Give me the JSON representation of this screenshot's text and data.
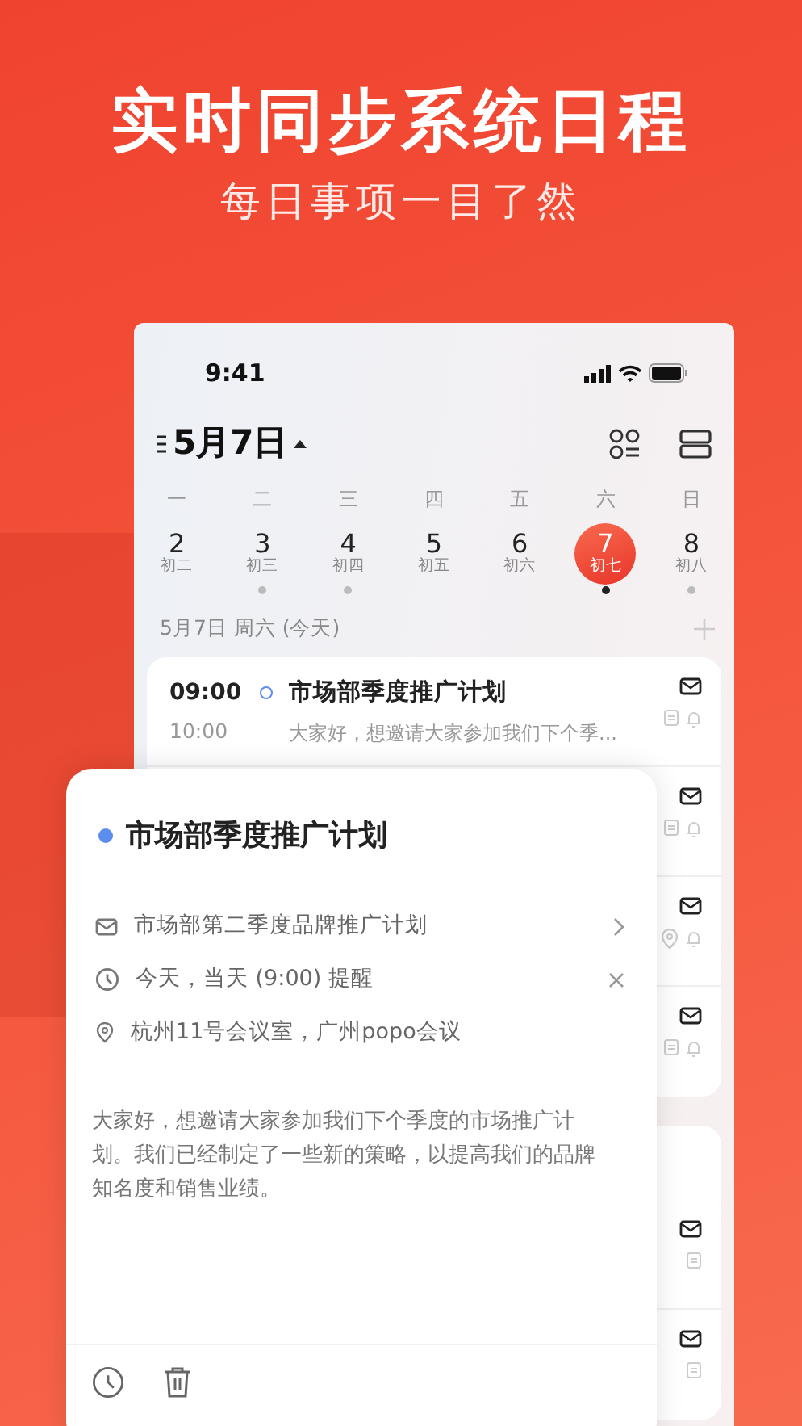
{
  "promo": {
    "title": "实时同步系统日程",
    "subtitle": "每日事项一目了然"
  },
  "status_bar": {
    "time": "9:41"
  },
  "header": {
    "date": "5月7日"
  },
  "week": [
    {
      "weekday": "一",
      "date": "2",
      "lunar": "初二",
      "selected": false,
      "has_events": false
    },
    {
      "weekday": "二",
      "date": "3",
      "lunar": "初三",
      "selected": false,
      "has_events": true
    },
    {
      "weekday": "三",
      "date": "4",
      "lunar": "初四",
      "selected": false,
      "has_events": true
    },
    {
      "weekday": "四",
      "date": "5",
      "lunar": "初五",
      "selected": false,
      "has_events": false
    },
    {
      "weekday": "五",
      "date": "6",
      "lunar": "初六",
      "selected": false,
      "has_events": false
    },
    {
      "weekday": "六",
      "date": "7",
      "lunar": "初七",
      "selected": true,
      "has_events": true
    },
    {
      "weekday": "日",
      "date": "8",
      "lunar": "初八",
      "selected": false,
      "has_events": true
    }
  ],
  "day_label": "5月7日 周六 (今天)",
  "event_groups": [
    {
      "events": [
        {
          "start": "09:00",
          "end": "10:00",
          "title": "市场部季度推广计划",
          "preview": "大家好，想邀请大家参加我们下个季...",
          "note": true,
          "location": false,
          "reminder": true
        },
        {
          "note": true,
          "location": false,
          "reminder": true
        },
        {
          "note": false,
          "location": true,
          "reminder": true
        },
        {
          "note": true,
          "location": false,
          "reminder": true
        }
      ]
    },
    {
      "events": [
        {
          "note": true,
          "location": false,
          "reminder": false
        },
        {
          "note": true,
          "location": false,
          "reminder": false
        }
      ]
    }
  ],
  "detail": {
    "title": "市场部季度推广计划",
    "rows": [
      {
        "kind": "mail",
        "text": "市场部第二季度品牌推广计划",
        "chevron": true
      },
      {
        "kind": "clock",
        "text": "今天，当天 (9:00) 提醒",
        "clear": true
      },
      {
        "kind": "location",
        "text": "杭州11号会议室，广州popo会议"
      }
    ],
    "description": "大家好，想邀请大家参加我们下个季度的市场推广计划。我们已经制定了一些新的策略，以提高我们的品牌知名度和销售业绩。"
  }
}
